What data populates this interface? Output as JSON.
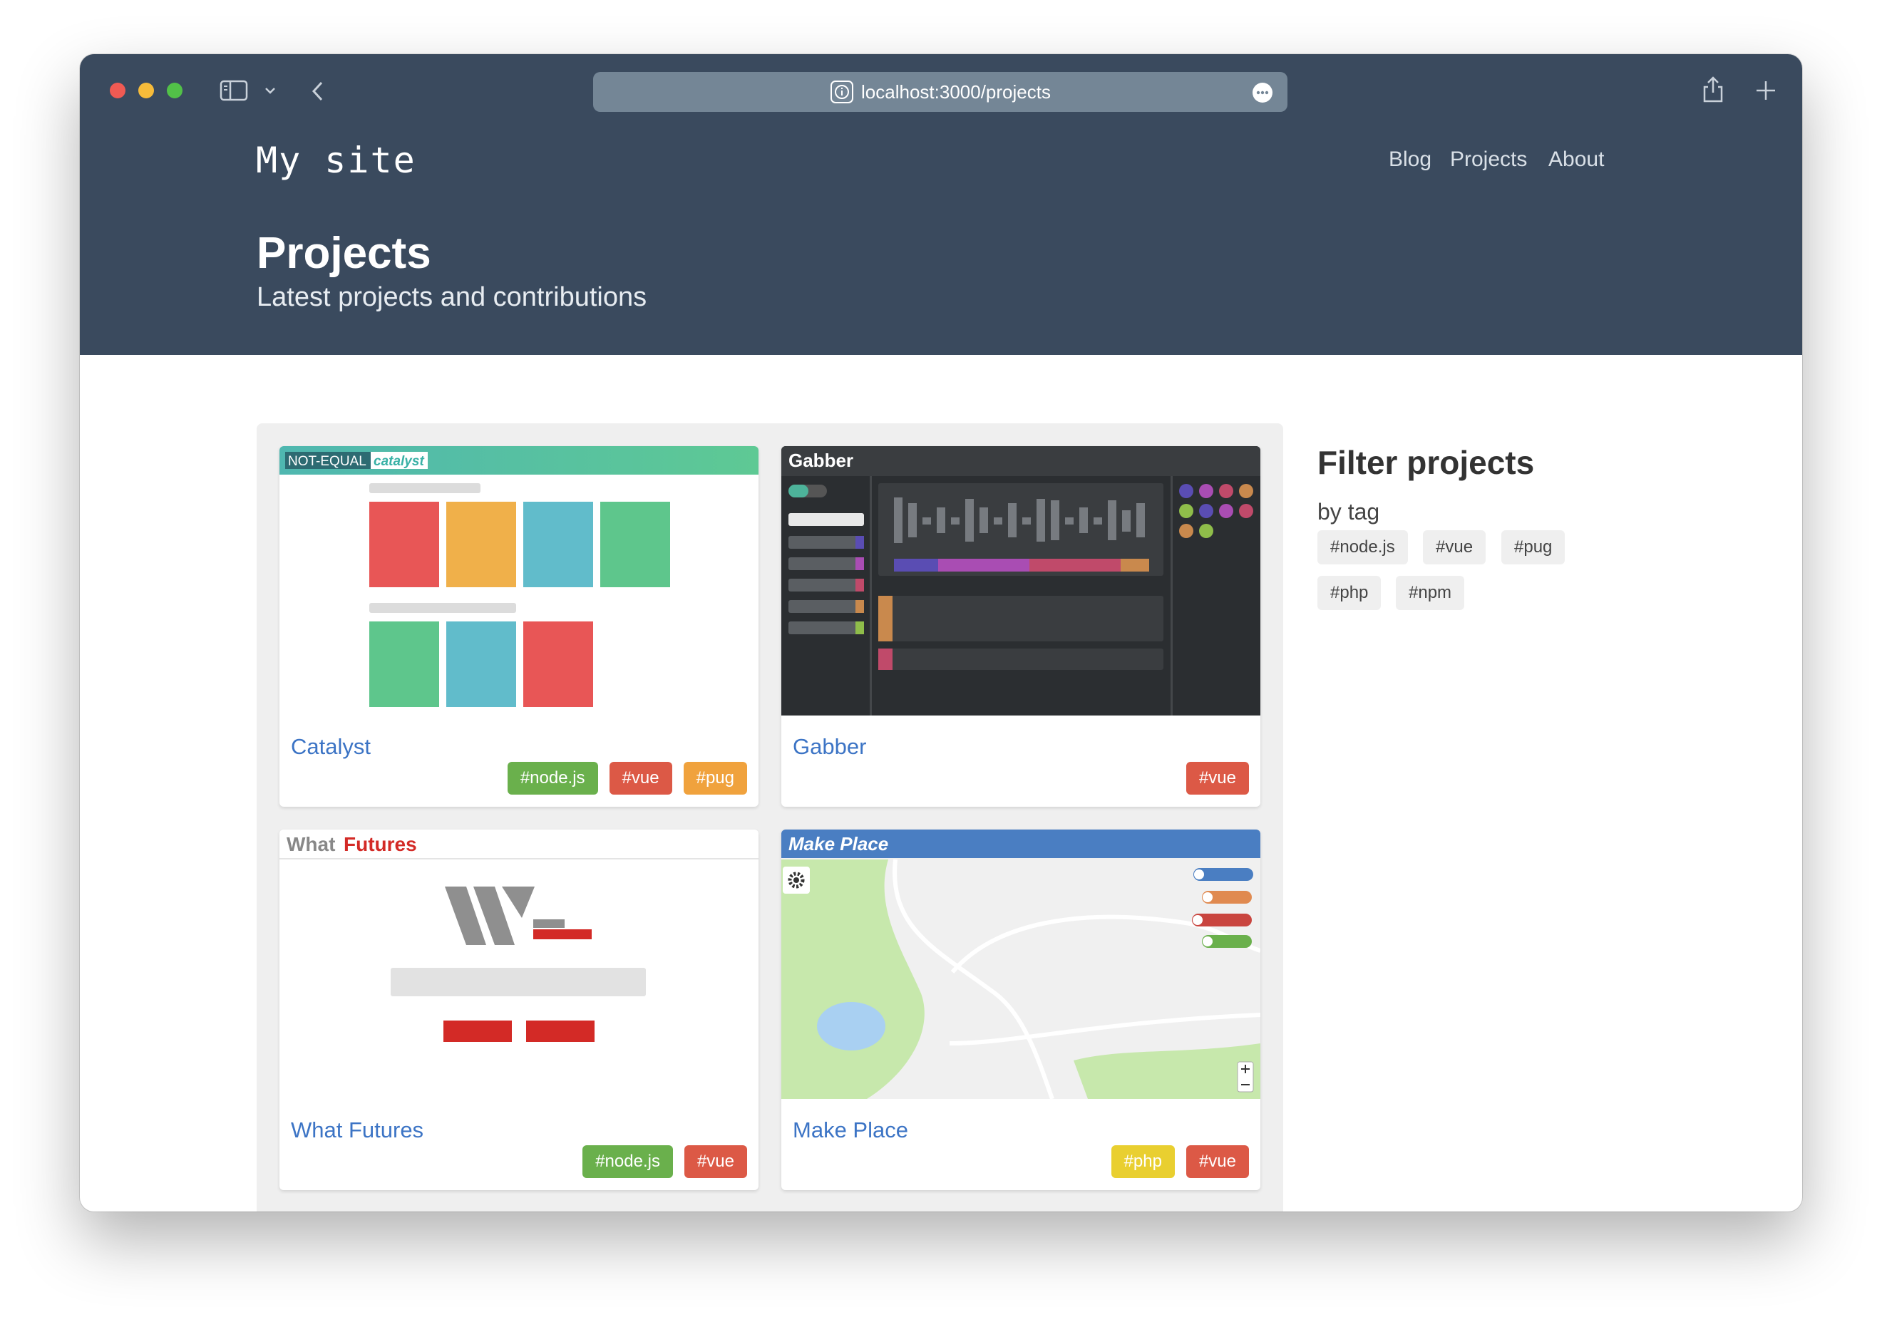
{
  "browser": {
    "url": "localhost:3000/projects"
  },
  "site": {
    "brand": "My site",
    "nav": [
      "Blog",
      "Projects",
      "About"
    ]
  },
  "page": {
    "title": "Projects",
    "subtitle": "Latest projects and contributions"
  },
  "projects": [
    {
      "name": "Catalyst",
      "banner": "NOT-EQUAL",
      "banner_accent": "catalyst",
      "tags": [
        {
          "label": "#node.js",
          "color": "#6ab04c"
        },
        {
          "label": "#vue",
          "color": "#dc5946"
        },
        {
          "label": "#pug",
          "color": "#f0a23d"
        }
      ]
    },
    {
      "name": "Gabber",
      "banner": "Gabber",
      "tags": [
        {
          "label": "#vue",
          "color": "#dc5946"
        }
      ]
    },
    {
      "name": "What Futures",
      "banner": "What",
      "banner_accent": "Futures",
      "tags": [
        {
          "label": "#node.js",
          "color": "#6ab04c"
        },
        {
          "label": "#vue",
          "color": "#dc5946"
        }
      ]
    },
    {
      "name": "Make Place",
      "banner": "Make Place",
      "tags": [
        {
          "label": "#php",
          "color": "#e9cf30"
        },
        {
          "label": "#vue",
          "color": "#dc5946"
        }
      ]
    }
  ],
  "filter": {
    "title": "Filter projects",
    "subtitle": "by tag",
    "tags": [
      "#node.js",
      "#vue",
      "#pug",
      "#php",
      "#npm"
    ]
  },
  "colors": {
    "header_bg": "#3a4a5e",
    "link": "#3c74c5"
  }
}
